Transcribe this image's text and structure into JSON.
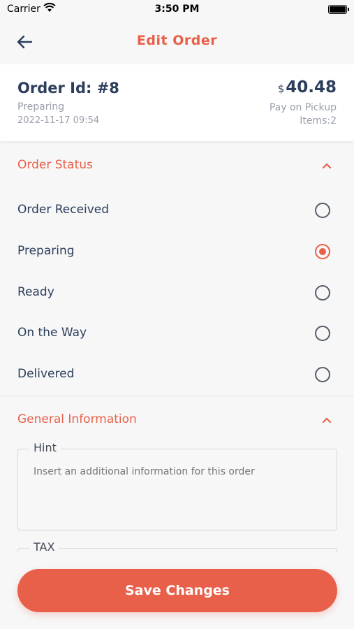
{
  "status_bar": {
    "carrier": "Carrier",
    "time": "3:50 PM"
  },
  "nav": {
    "title": "Edit Order",
    "back_icon": "arrow-left-icon"
  },
  "order": {
    "id_label": "Order Id: #8",
    "status": "Preparing",
    "date": "2022-11-17 09:54",
    "currency": "$",
    "total": "40.48",
    "payment": "Pay on Pickup",
    "items": "Items:2"
  },
  "order_status": {
    "title": "Order Status",
    "options": [
      {
        "label": "Order Received",
        "selected": false
      },
      {
        "label": "Preparing",
        "selected": true
      },
      {
        "label": "Ready",
        "selected": false
      },
      {
        "label": "On the Way",
        "selected": false
      },
      {
        "label": "Delivered",
        "selected": false
      }
    ]
  },
  "general_info": {
    "title": "General Information",
    "hint_label": "Hint",
    "hint_placeholder": "Insert an additional information for this order",
    "tax_label": "TAX"
  },
  "actions": {
    "save_label": "Save Changes"
  },
  "colors": {
    "accent": "#e8604a",
    "text": "#2c3e5c",
    "muted": "#9aa0aa",
    "background": "#f7f7f7"
  }
}
